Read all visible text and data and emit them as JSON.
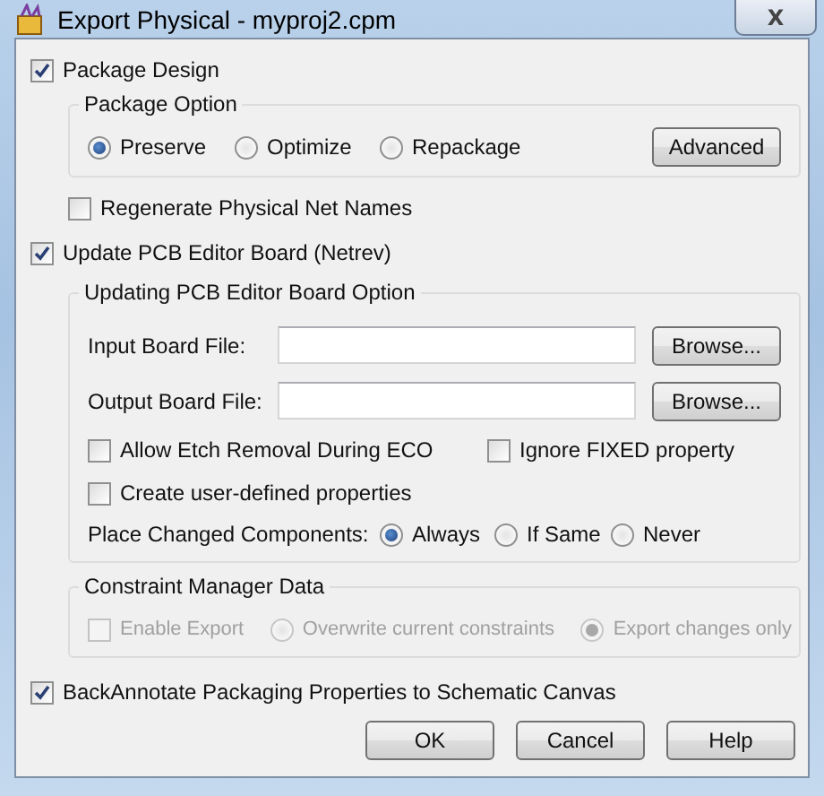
{
  "window": {
    "title": "Export Physical - myproj2.cpm",
    "close": "X"
  },
  "package_design": {
    "label": "Package Design",
    "checked": true
  },
  "package_option": {
    "title": "Package Option",
    "radios": [
      {
        "label": "Preserve",
        "selected": true
      },
      {
        "label": "Optimize",
        "selected": false
      },
      {
        "label": "Repackage",
        "selected": false
      }
    ],
    "button": "Advanced"
  },
  "regenerate": {
    "label": "Regenerate Physical Net Names",
    "checked": false
  },
  "update_board": {
    "label": "Update PCB Editor Board (Netrev)",
    "checked": true
  },
  "board_option": {
    "title": "Updating PCB Editor Board Option",
    "files": [
      {
        "label": "Input Board File:",
        "button": "Browse..."
      },
      {
        "label": "Output Board File:",
        "button": "Browse..."
      }
    ],
    "checks": [
      {
        "label": "Allow Etch Removal During ECO",
        "checked": false
      },
      {
        "label": "Ignore FIXED property",
        "checked": false
      },
      {
        "label": "Create user-defined properties",
        "checked": false
      }
    ],
    "place": {
      "label": "Place Changed Components:",
      "radios": [
        {
          "label": "Always",
          "selected": true
        },
        {
          "label": "If Same",
          "selected": false
        },
        {
          "label": "Never",
          "selected": false
        }
      ]
    }
  },
  "constraint": {
    "title": "Constraint Manager Data",
    "disabled": true,
    "enable": {
      "label": "Enable Export",
      "checked": false
    },
    "radios": [
      {
        "label": "Overwrite current constraints",
        "selected": false
      },
      {
        "label": "Export changes only",
        "selected": true
      }
    ]
  },
  "backannotate": {
    "label": "BackAnnotate Packaging Properties to Schematic Canvas",
    "checked": true
  },
  "buttons": [
    "OK",
    "Cancel",
    "Help"
  ]
}
